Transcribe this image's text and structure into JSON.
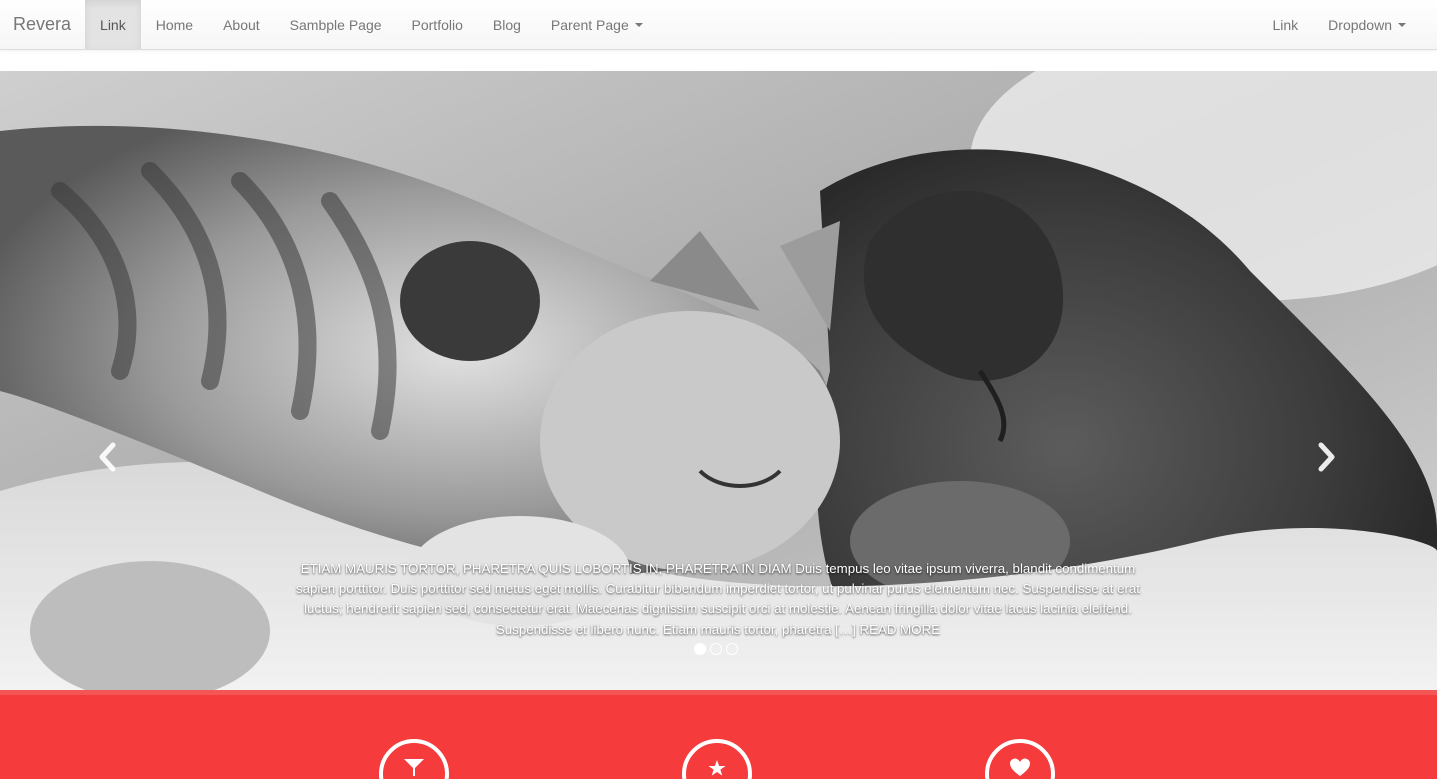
{
  "navbar": {
    "brand": "Revera",
    "left_items": [
      {
        "label": "Link",
        "active": true
      },
      {
        "label": "Home"
      },
      {
        "label": "About"
      },
      {
        "label": "Sambple Page"
      },
      {
        "label": "Portfolio"
      },
      {
        "label": "Blog"
      },
      {
        "label": "Parent Page"
      }
    ],
    "right_items": [
      {
        "label": "Link"
      },
      {
        "label": "Dropdown"
      }
    ]
  },
  "carousel": {
    "caption_head": "Etiam mauris tortor, pharetra quis lobortis in, pharetra in diam",
    "caption_body": " Duis tempus leo vitae ipsum viverra, blandit condimentum sapien porttitor. Duis porttitor sed metus eget mollis. Curabitur bibendum imperdiet tortor, ut pulvinar purus elementum nec. Suspendisse at erat luctus; hendrerit sapien sed, consectetur erat. Maecenas dignissim suscipit orci at molestie. Aenean fringilla dolor vitae lacus lacinia eleifend. Suspendisse et libero nunc. Etiam mauris tortor, pharetra […] ",
    "read_more": "READ MORE",
    "slide_count": 3,
    "active_slide": 1,
    "image_subject": "kitten-and-puppy-sleeping-photo"
  },
  "features": {
    "accent_color": "#f53b3b",
    "icons": [
      "cocktail-icon",
      "star-icon",
      "heart-icon"
    ]
  }
}
